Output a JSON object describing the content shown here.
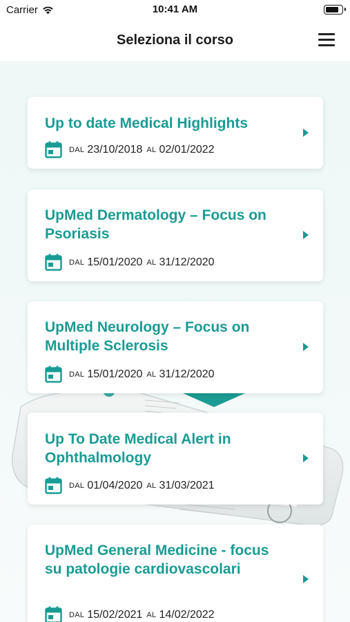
{
  "status_bar": {
    "carrier": "Carrier",
    "time": "10:41 AM"
  },
  "nav": {
    "title": "Seleziona il corso"
  },
  "colors": {
    "accent": "#1a9b94",
    "background": "#eef8f7"
  },
  "courses": [
    {
      "title": "Up to date Medical Highlights",
      "from_label": "DAL",
      "from": "23/10/2018",
      "to_label": "AL",
      "to": "02/01/2022"
    },
    {
      "title": "UpMed Dermatology – Focus on Psoriasis",
      "from_label": "DAL",
      "from": "15/01/2020",
      "to_label": "AL",
      "to": "31/12/2020"
    },
    {
      "title": "UpMed Neurology – Focus on Multiple Sclerosis",
      "from_label": "DAL",
      "from": "15/01/2020",
      "to_label": "AL",
      "to": "31/12/2020"
    },
    {
      "title": "Up To Date Medical Alert in Ophthalmology",
      "from_label": "DAL",
      "from": "01/04/2020",
      "to_label": "AL",
      "to": "31/03/2021"
    },
    {
      "title": "UpMed General Medicine - focus su patologie cardiovascolari",
      "from_label": "DAL",
      "from": "15/02/2021",
      "to_label": "AL",
      "to": "14/02/2022"
    }
  ]
}
